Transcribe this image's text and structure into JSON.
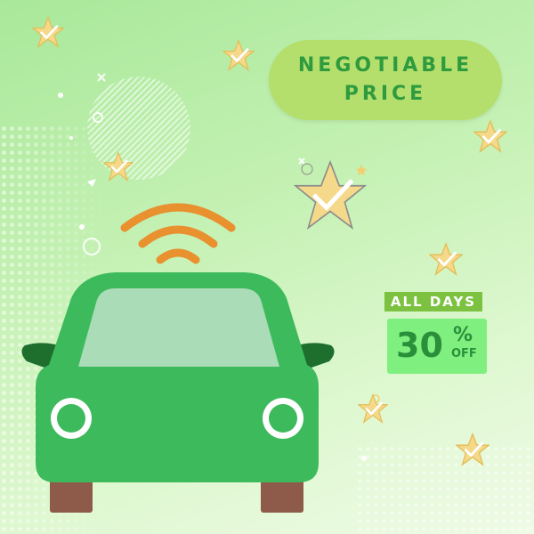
{
  "badge": {
    "line1": "NEGOTIABLE",
    "line2": "PRICE"
  },
  "offer": {
    "tag": "ALL DAYS",
    "number": "30",
    "percent": "%",
    "off": "OFF"
  },
  "icons": [
    "check-star-icon",
    "signal-waves-icon",
    "car-icon"
  ],
  "colors": {
    "background_start": "#a9e89a",
    "background_end": "#eefbe6",
    "car_body": "#3dba5c",
    "car_window": "#a9dcb7",
    "signal_waves": "#e9902f",
    "badge_fill": "#b5df6c",
    "badge_text": "#2e9b3f",
    "offer_tag": "#7cc240",
    "offer_box": "#7ff07f"
  }
}
